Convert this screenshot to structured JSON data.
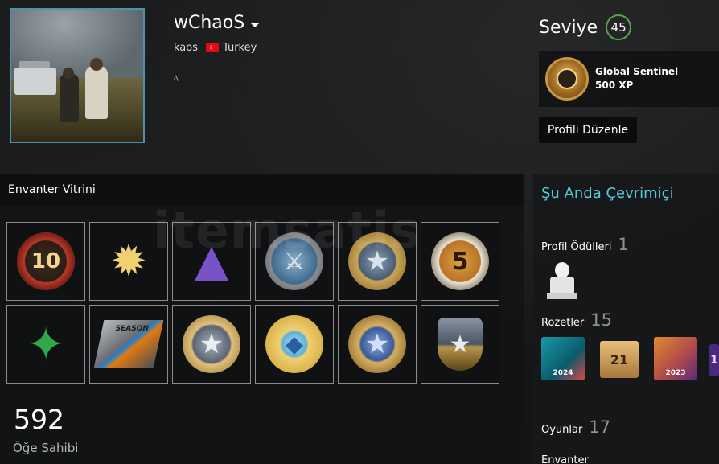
{
  "profile": {
    "username": "wChaoS",
    "real_name": "kaos",
    "country": "Turkey",
    "summary": "ﾍ"
  },
  "level": {
    "label": "Seviye",
    "value": "45"
  },
  "favorite_badge": {
    "name": "Global Sentinel",
    "xp": "500 XP"
  },
  "edit_profile_label": "Profili Düzenle",
  "showcase": {
    "title": "Envanter Vitrini",
    "items": [
      {
        "label": "10"
      },
      {
        "label": ""
      },
      {
        "label": ""
      },
      {
        "label": ""
      },
      {
        "label": ""
      },
      {
        "label": "5"
      },
      {
        "label": ""
      },
      {
        "label": "SEASON"
      },
      {
        "label": ""
      },
      {
        "label": ""
      },
      {
        "label": ""
      },
      {
        "label": ""
      }
    ],
    "count": "592",
    "count_label": "Öğe Sahibi"
  },
  "sidebar": {
    "status": "Şu Anda Çevrimiçi",
    "awards_label": "Profil Ödülleri",
    "awards_count": "1",
    "badges_label": "Rozetler",
    "badges_count": "15",
    "badges": [
      {
        "label": "2024"
      },
      {
        "label": "21"
      },
      {
        "label": "2023"
      },
      {
        "label": "1"
      }
    ],
    "games_label": "Oyunlar",
    "games_count": "17",
    "inventory_label": "Envanter"
  },
  "watermark": "itemsatis",
  "colors": {
    "accent_online": "#57cbde",
    "level_ring": "#59a14a",
    "avatar_border": "#4c91ad"
  }
}
